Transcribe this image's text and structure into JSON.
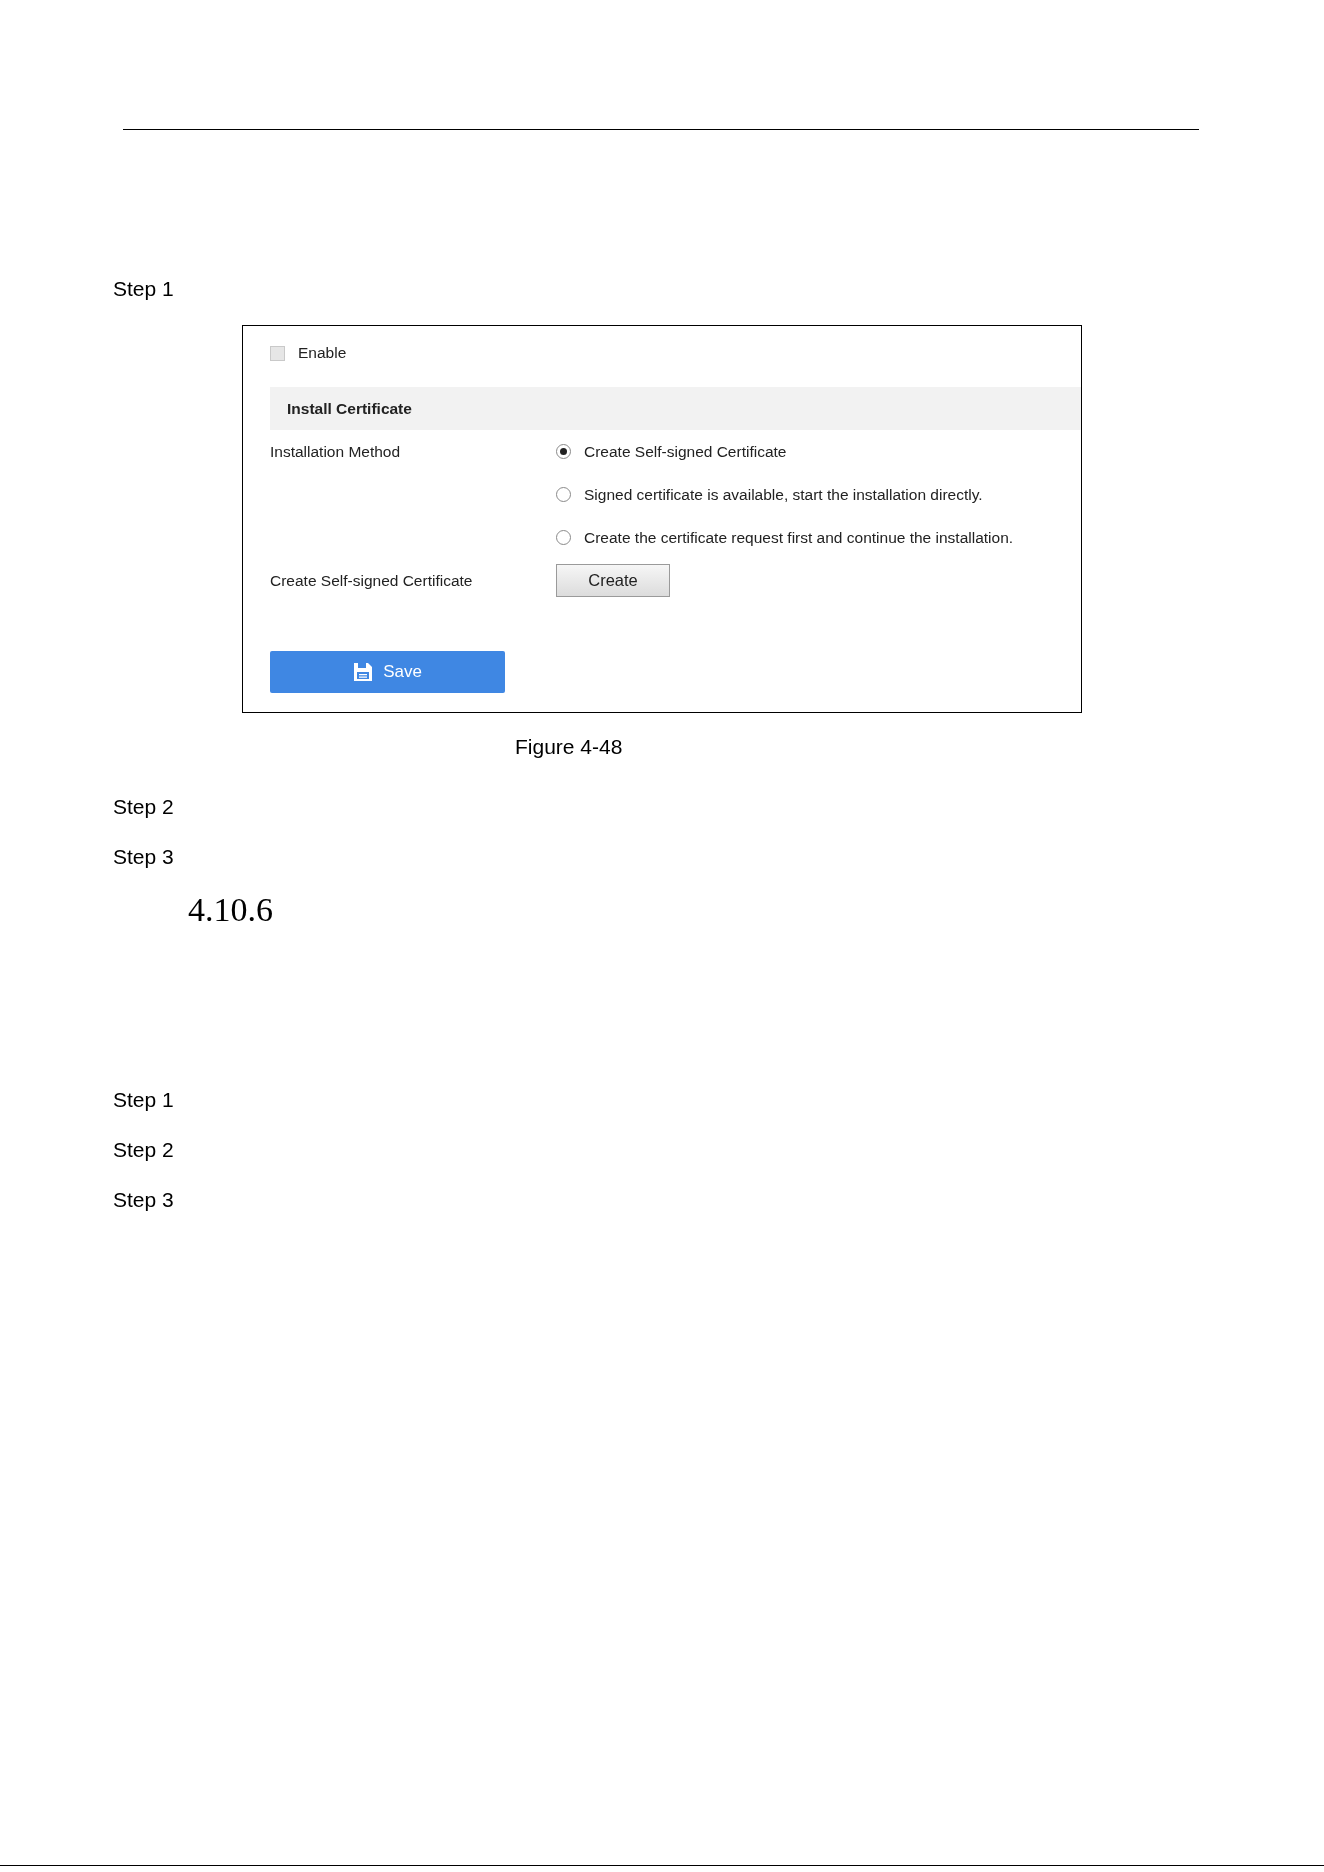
{
  "steps_before": [
    "Step 1"
  ],
  "figure": {
    "enable": {
      "label": "Enable",
      "checked": false
    },
    "section_title": "Install Certificate",
    "installation_method": {
      "label": "Installation Method",
      "options": [
        {
          "label": "Create Self-signed Certificate",
          "selected": true
        },
        {
          "label": "Signed certificate is available, start the installation directly.",
          "selected": false
        },
        {
          "label": "Create the certificate request first and continue the installation.",
          "selected": false
        }
      ]
    },
    "create_row": {
      "label": "Create Self-signed Certificate",
      "button": "Create"
    },
    "save_button": "Save"
  },
  "figure_caption": "Figure 4-48",
  "steps_after_figure": [
    "Step 2",
    "Step 3"
  ],
  "section_heading": "4.10.6",
  "steps_section": [
    "Step 1",
    "Step 2",
    "Step 3"
  ]
}
